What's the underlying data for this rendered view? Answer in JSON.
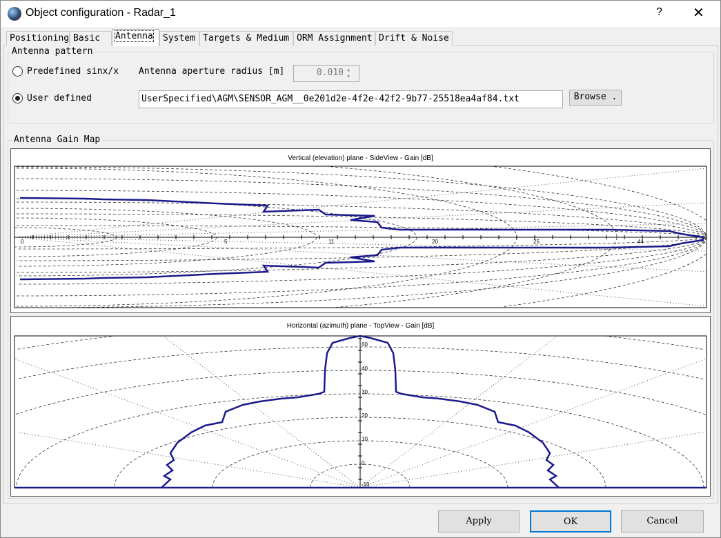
{
  "window": {
    "title": "Object configuration - Radar_1",
    "help": "?",
    "close": "✕"
  },
  "tabs": [
    {
      "label": "Positioning"
    },
    {
      "label": "Basic"
    },
    {
      "label": "Antenna",
      "active": true
    },
    {
      "label": "System"
    },
    {
      "label": "Targets & Medium"
    },
    {
      "label": "ORM Assignment"
    },
    {
      "label": "Drift & Noise"
    }
  ],
  "antenna_pattern": {
    "group_label": "Antenna pattern",
    "predefined_label": "Predefined sinx/x",
    "aperture_label": "Antenna aperture radius [m]",
    "aperture_value": "0.010",
    "user_defined_label": "User defined",
    "selected": "user_defined",
    "file_path": "UserSpecified\\AGM\\SENSOR_AGM__0e201d2e-4f2e-42f2-9b77-25518ea4af84.txt",
    "browse_label": "Browse ."
  },
  "gain_map": {
    "group_label": "Antenna Gain Map",
    "side_view": {
      "title": "Vertical (elevation) plane - SideView - Gain [dB]",
      "tick_labels": [
        "0",
        "5",
        "11",
        "20",
        "25",
        "44"
      ]
    },
    "top_view": {
      "title": "Horizontal (azimuth) plane - TopView - Gain [dB]",
      "tick_labels": [
        "60",
        "40",
        "30",
        "20",
        "10",
        "0",
        "-10"
      ]
    },
    "pattern_color": "#1a1a8c"
  },
  "buttons": {
    "apply": "Apply",
    "ok": "OK",
    "cancel": "Cancel"
  }
}
